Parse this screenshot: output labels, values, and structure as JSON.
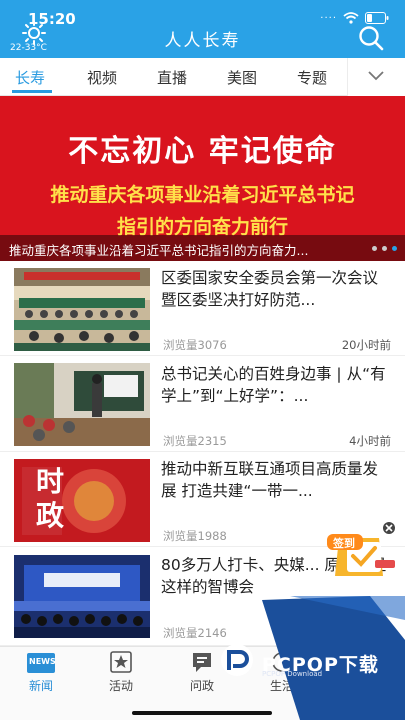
{
  "status": {
    "time": "15:20",
    "temperature": "22-33°C",
    "dots": "····"
  },
  "header": {
    "title": "人人长寿"
  },
  "tabs": [
    {
      "label": "长寿",
      "active": true
    },
    {
      "label": "视频"
    },
    {
      "label": "直播"
    },
    {
      "label": "美图"
    },
    {
      "label": "专题"
    }
  ],
  "banner": {
    "headline": "不忘初心 牢记使命",
    "line1": "推动重庆各项事业沿着习近平总书记",
    "line2": "指引的方向奋力前行",
    "caption": "推动重庆各项事业沿着习近平总书记指引的方向奋力...",
    "slides": 3,
    "active_slide": 3
  },
  "news": [
    {
      "title": "区委国家安全委员会第一次会议暨区委坚决打好防范...",
      "views": "浏览量3076",
      "time": "20小时前",
      "thumb": "meeting-hall"
    },
    {
      "title": "总书记关心的百姓身边事 | 从“有学上”到“上好学”：...",
      "views": "浏览量2315",
      "time": "4小时前",
      "thumb": "classroom"
    },
    {
      "title": "推动中新互联互通项目高质量发展 打造共建“一带一...",
      "views": "浏览量1988",
      "time": "",
      "thumb": "shizheng-logo",
      "thumb_text": "时政"
    },
    {
      "title": "80多万人打卡、央媒... 原来你是这样的智博会",
      "views": "浏览量2146",
      "time": "",
      "thumb": "expo-stage"
    }
  ],
  "bottom_nav": [
    {
      "label": "新闻",
      "icon": "news-icon",
      "badge": "NEWS",
      "active": true
    },
    {
      "label": "活动",
      "icon": "star-icon"
    },
    {
      "label": "问政",
      "icon": "chat-icon"
    },
    {
      "label": "生活",
      "icon": "life-icon"
    }
  ],
  "floating": {
    "label": "签到"
  },
  "watermark": {
    "text": "PCPOP下载",
    "sub": "PCPOP Download"
  },
  "colors": {
    "header": "#2aa2e6",
    "banner_red": "#d9141e",
    "accent": "#2a9be0"
  }
}
